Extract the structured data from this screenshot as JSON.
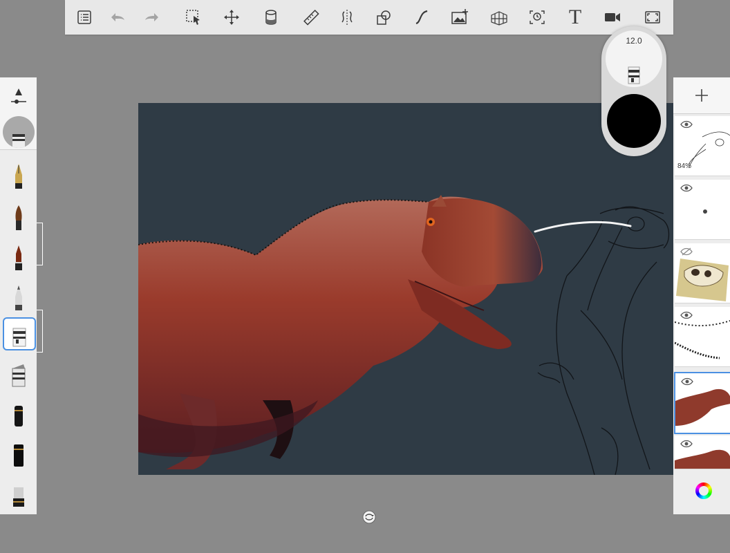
{
  "toolbar": {
    "tools": [
      {
        "name": "list-icon"
      },
      {
        "name": "undo-icon"
      },
      {
        "name": "redo-icon"
      },
      {
        "name": "selection-icon"
      },
      {
        "name": "transform-icon"
      },
      {
        "name": "fill-icon"
      },
      {
        "name": "ruler-icon"
      },
      {
        "name": "symmetry-icon"
      },
      {
        "name": "shapes-icon"
      },
      {
        "name": "curve-icon"
      },
      {
        "name": "add-image-icon"
      },
      {
        "name": "perspective-icon"
      },
      {
        "name": "time-lapse-icon"
      },
      {
        "name": "text-icon"
      },
      {
        "name": "record-icon"
      },
      {
        "name": "fullscreen-icon"
      }
    ],
    "text_tool_glyph": "T"
  },
  "puck": {
    "brush_size": "12.0",
    "color": "#000000"
  },
  "layers": [
    {
      "name": "sketch-head",
      "opacity": "84%",
      "visible": true
    },
    {
      "name": "dot-layer",
      "visible": true
    },
    {
      "name": "skull-reference",
      "visible": false
    },
    {
      "name": "scales-layer",
      "visible": true
    },
    {
      "name": "dinosaur-paint",
      "visible": true,
      "selected": true
    },
    {
      "name": "dinosaur-base",
      "visible": true
    }
  ],
  "colors": {
    "canvas_bg": "#2f3b45",
    "workspace": "#8a8a8a",
    "accent": "#4a90e2"
  }
}
